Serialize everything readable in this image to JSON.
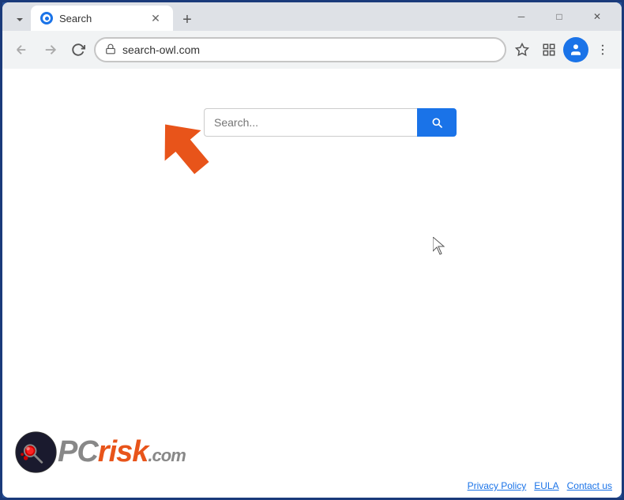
{
  "browser": {
    "tab": {
      "title": "Search",
      "favicon_color": "#1a73e8"
    },
    "new_tab_label": "+",
    "window_controls": {
      "minimize": "─",
      "maximize": "□",
      "close": "✕"
    }
  },
  "navbar": {
    "back_label": "←",
    "forward_label": "→",
    "reload_label": "↻",
    "address": "search-owl.com",
    "bookmark_label": "☆",
    "extensions_label": "⧉",
    "menu_label": "⋮"
  },
  "page": {
    "search_placeholder": "Search...",
    "search_button_label": "🔍",
    "footer_links": [
      {
        "label": "Privacy Policy",
        "id": "privacy-policy"
      },
      {
        "label": "EULA",
        "id": "eula"
      },
      {
        "label": "Contact us",
        "id": "contact-us"
      }
    ]
  },
  "logo": {
    "pc": "PC",
    "risk": "risk",
    "com": ".com"
  }
}
